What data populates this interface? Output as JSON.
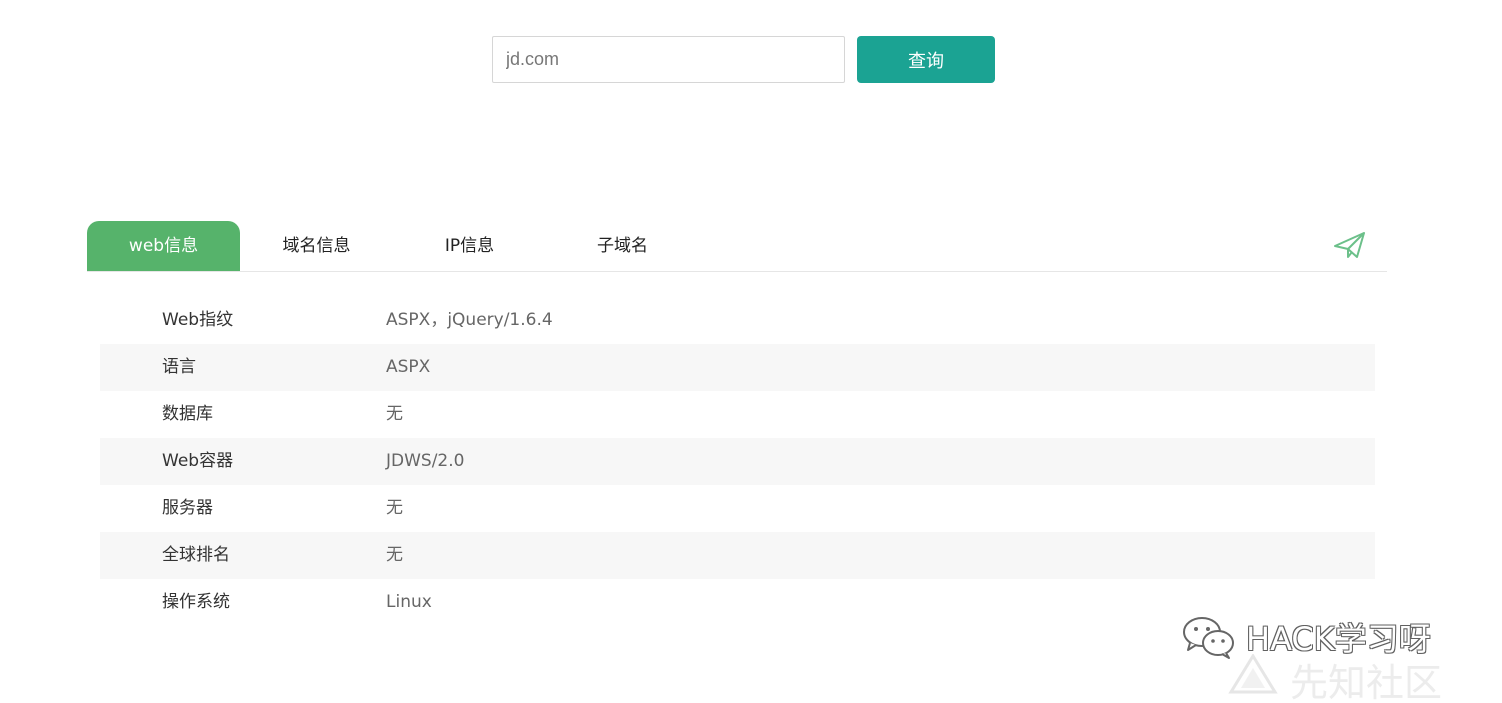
{
  "search": {
    "value": "jd.com",
    "button_label": "查询"
  },
  "tabs": [
    {
      "label": "web信息",
      "active": true
    },
    {
      "label": "域名信息",
      "active": false
    },
    {
      "label": "IP信息",
      "active": false
    },
    {
      "label": "子域名",
      "active": false
    }
  ],
  "share_icon": "paper-plane-icon",
  "info_rows": [
    {
      "label": "Web指纹",
      "value": "ASPX，jQuery/1.6.4"
    },
    {
      "label": "语言",
      "value": "ASPX"
    },
    {
      "label": "数据库",
      "value": "无"
    },
    {
      "label": "Web容器",
      "value": "JDWS/2.0"
    },
    {
      "label": "服务器",
      "value": "无"
    },
    {
      "label": "全球排名",
      "value": "无"
    },
    {
      "label": "操作系统",
      "value": "Linux"
    }
  ],
  "watermark": {
    "brand": "HACK学习呀",
    "community": "先知社区",
    "icon": "wechat-icon"
  },
  "colors": {
    "accent_button": "#1ba393",
    "active_tab": "#56b36b",
    "row_alt_bg": "#f7f7f7"
  }
}
